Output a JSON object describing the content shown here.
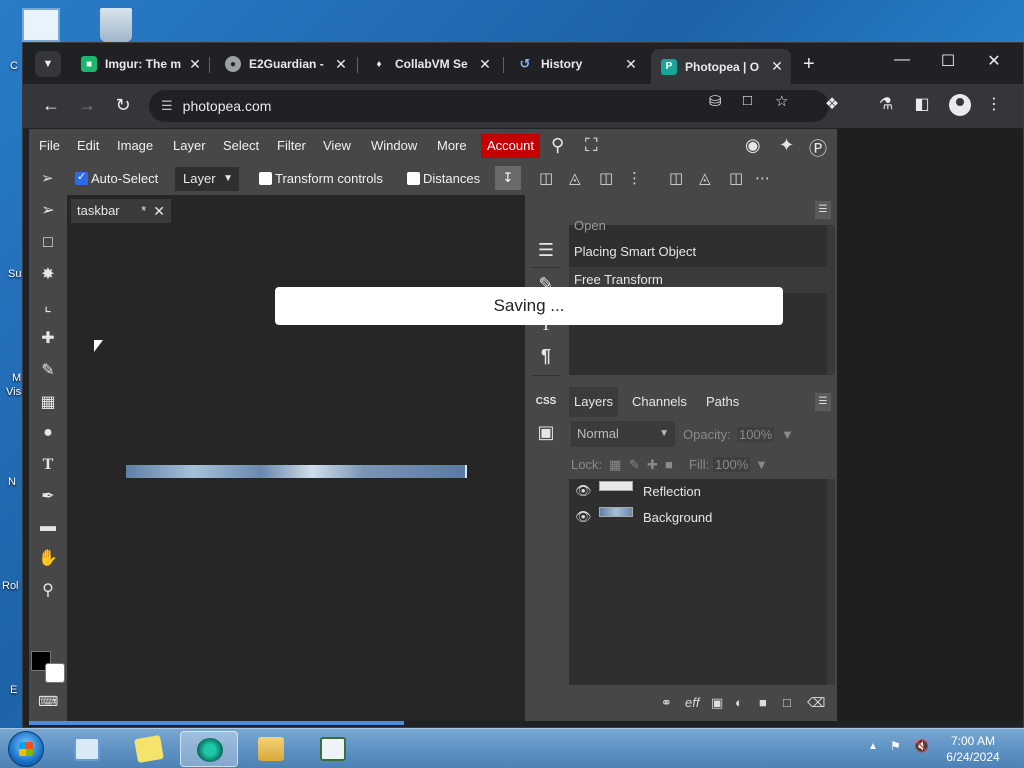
{
  "desktop": {
    "icon_labels": [
      "C",
      "Su",
      "M",
      "Vis",
      "N",
      "Rol",
      "E"
    ]
  },
  "browser": {
    "tabs": [
      {
        "title": "Imgur: The m",
        "favicon": "imgur-icon"
      },
      {
        "title": "E2Guardian -",
        "favicon": "globe-icon"
      },
      {
        "title": "CollabVM Se",
        "favicon": "collabvm-icon"
      },
      {
        "title": "History",
        "favicon": "history-icon"
      },
      {
        "title": "Photopea | O",
        "favicon": "photopea-icon"
      }
    ],
    "url": "photopea.com"
  },
  "photopea": {
    "menu": [
      "File",
      "Edit",
      "Image",
      "Layer",
      "Select",
      "Filter",
      "View",
      "Window",
      "More"
    ],
    "account_label": "Account",
    "options": {
      "auto_select_label": "Auto-Select",
      "layer_select_value": "Layer",
      "transform_controls_label": "Transform controls",
      "distances_label": "Distances"
    },
    "document_tab": {
      "name": "taskbar",
      "modified_mark": "*"
    },
    "saving_message": "Saving ...",
    "history": [
      "Open",
      "Placing Smart Object",
      "Free Transform"
    ],
    "panel_tabs": [
      "Layers",
      "Channels",
      "Paths"
    ],
    "blend_mode": "Normal",
    "opacity_label": "Opacity:",
    "opacity_value": "100%",
    "lock_label": "Lock:",
    "fill_label": "Fill:",
    "fill_value": "100%",
    "layers": [
      {
        "name": "Reflection",
        "visible": true
      },
      {
        "name": "Background",
        "visible": true
      }
    ],
    "css_label": "CSS",
    "layers_footer_eff": "eff",
    "colors": {
      "accent_account": "#c50000",
      "panel_bg": "#474747",
      "canvas_bg": "#262626"
    }
  },
  "taskbar": {
    "time": "7:00 AM",
    "date": "6/24/2024"
  }
}
